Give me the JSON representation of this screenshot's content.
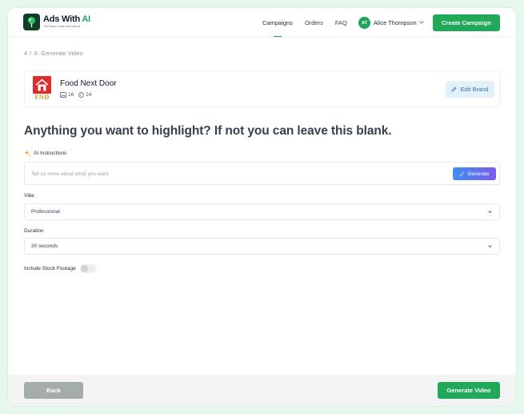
{
  "app": {
    "logo_name_prefix": "Ads With ",
    "logo_name_accent": "AI",
    "tagline": "The future of ads, built with AI"
  },
  "nav": {
    "items": [
      {
        "label": "Campaigns",
        "active": true
      },
      {
        "label": "Orders",
        "active": false
      },
      {
        "label": "FAQ",
        "active": false
      }
    ]
  },
  "user": {
    "initials": "AT",
    "name": "Alice Thompson"
  },
  "header": {
    "create_label": "Create Campaign"
  },
  "step": {
    "counter": "4 / 4",
    "title": "Generate Video"
  },
  "brand": {
    "name": "Food Next Door",
    "logo_text": "FND",
    "stat_images": "16",
    "stat_assets": "24",
    "edit_label": "Edit Brand"
  },
  "headline": "Anything you want to highlight? If not you can leave this blank.",
  "ai_instructions": {
    "label": "AI Instructions",
    "placeholder": "Tell us more about what you want",
    "value": "",
    "button": "Generate"
  },
  "vibe": {
    "label": "Vibe",
    "value": "Professional"
  },
  "duration": {
    "label": "Duration",
    "value": "30 seconds"
  },
  "stock_footage": {
    "label": "Include Stock Footage",
    "enabled": false
  },
  "footer": {
    "back_label": "Back",
    "generate_label": "Generate Video"
  },
  "colors": {
    "accent": "#21a859",
    "background": "#e6f8ee",
    "edit_brand_bg": "#e3f1fb",
    "back_button": "#a5adaa",
    "generate_gradient_start": "#3f8ef0",
    "generate_gradient_end": "#7b5cf0"
  }
}
